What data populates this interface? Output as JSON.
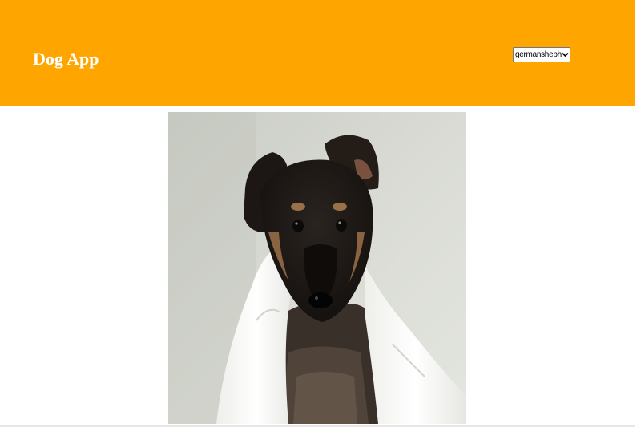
{
  "app": {
    "title": "Dog App"
  },
  "breed_select": {
    "selected": "germanshepherd"
  },
  "photo": {
    "subject": "German Shepherd puppy wrapped in a white towel"
  },
  "colors": {
    "header_bg": "#ffa500",
    "title_text": "#ffffff",
    "page_bg": "#ffffff"
  }
}
